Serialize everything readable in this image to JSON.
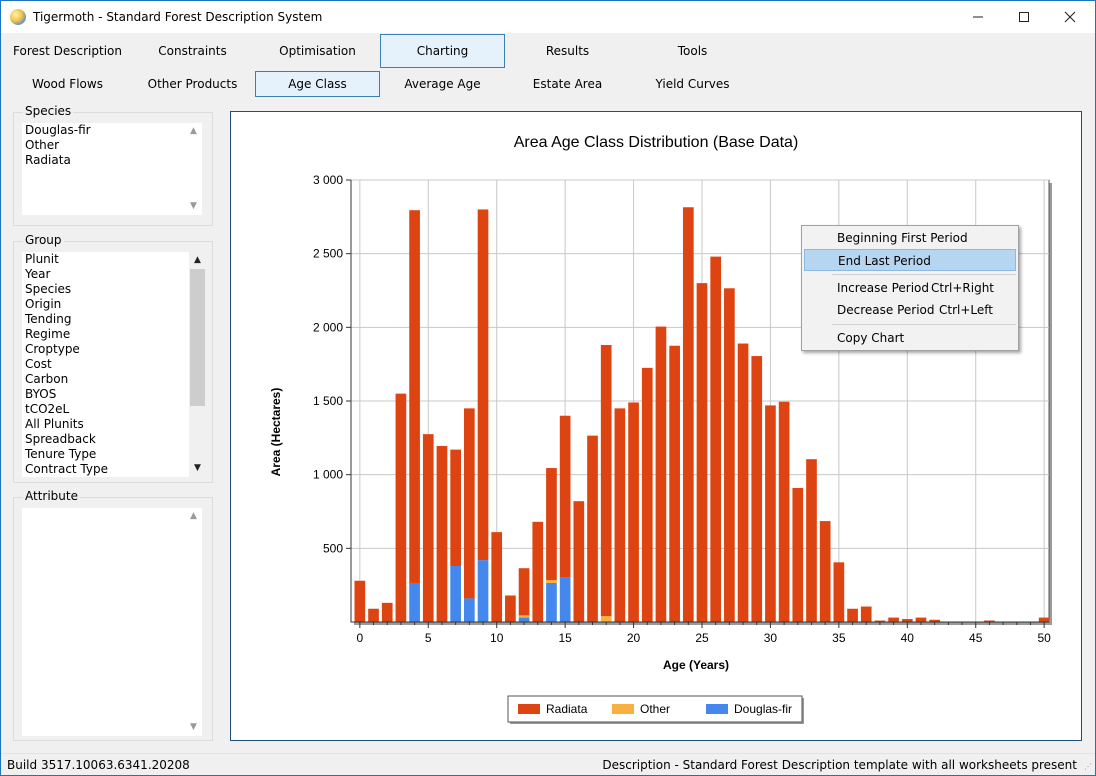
{
  "window": {
    "title": "Tigermoth - Standard Forest Description System",
    "icon": "globe-icon"
  },
  "tabs_row1": [
    {
      "label": "Forest Description"
    },
    {
      "label": "Constraints"
    },
    {
      "label": "Optimisation"
    },
    {
      "label": "Charting"
    },
    {
      "label": "Results"
    },
    {
      "label": "Tools"
    }
  ],
  "tabs_row2": [
    {
      "label": "Wood Flows"
    },
    {
      "label": "Other Products"
    },
    {
      "label": "Age Class"
    },
    {
      "label": "Average Age"
    },
    {
      "label": "Estate Area"
    },
    {
      "label": "Yield Curves"
    }
  ],
  "species": {
    "label": "Species",
    "items": [
      "Douglas-fir",
      "Other",
      "Radiata"
    ]
  },
  "group": {
    "label": "Group",
    "items": [
      "Plunit",
      "Year",
      "Species",
      "Origin",
      "Tending",
      "Regime",
      "Croptype",
      "Cost",
      "Carbon",
      "BYOS",
      "tCO2eL",
      "All Plunits",
      "Spreadback",
      "Tenure Type",
      "Contract Type"
    ]
  },
  "attribute": {
    "label": "Attribute"
  },
  "context_menu": {
    "items": [
      {
        "label": "Beginning First Period",
        "shortcut": ""
      },
      {
        "label": "End Last Period",
        "shortcut": ""
      },
      {
        "label": "Increase Period",
        "shortcut": "Ctrl+Right"
      },
      {
        "label": "Decrease Period",
        "shortcut": "Ctrl+Left"
      },
      {
        "label": "Copy Chart",
        "shortcut": ""
      }
    ]
  },
  "status": {
    "build": "Build 3517.10063.6341.20208",
    "description": "Description - Standard Forest Description template with all worksheets present"
  },
  "colors": {
    "radiata": "#dd4411",
    "other": "#f8b040",
    "douglas": "#4488ee",
    "accent": "#3c7fb1"
  },
  "chart_data": {
    "type": "bar",
    "stacked": true,
    "title": "Area Age Class Distribution (Base Data)",
    "xlabel": "Age (Years)",
    "ylabel": "Area (Hectares)",
    "xlim": [
      0,
      50
    ],
    "ylim": [
      0,
      3000
    ],
    "x_ticks": [
      "0",
      "5",
      "10",
      "15",
      "20",
      "25",
      "30",
      "35",
      "40",
      "45",
      "50"
    ],
    "y_ticks": [
      "500",
      "1 000",
      "1 500",
      "2 000",
      "2 500",
      "3 000"
    ],
    "grid": true,
    "legend_position": "bottom",
    "x": [
      0,
      1,
      2,
      3,
      4,
      5,
      6,
      7,
      8,
      9,
      10,
      11,
      12,
      13,
      14,
      15,
      16,
      17,
      18,
      19,
      20,
      21,
      22,
      23,
      24,
      25,
      26,
      27,
      28,
      29,
      30,
      31,
      32,
      33,
      34,
      35,
      36,
      37,
      38,
      39,
      40,
      41,
      42,
      43,
      44,
      45,
      46,
      47,
      48,
      49,
      50
    ],
    "series": [
      {
        "name": "Radiata",
        "color": "#dd4411",
        "values": [
          280,
          90,
          130,
          1550,
          2530,
          1275,
          1195,
          790,
          1290,
          2380,
          610,
          180,
          320,
          680,
          760,
          1095,
          820,
          1265,
          1840,
          1450,
          1490,
          1725,
          2005,
          1875,
          2815,
          2300,
          2480,
          2265,
          1890,
          1805,
          1470,
          1495,
          910,
          1105,
          685,
          405,
          90,
          105,
          10,
          30,
          20,
          30,
          15,
          0,
          0,
          0,
          10,
          0,
          0,
          0,
          30
        ]
      },
      {
        "name": "Other",
        "color": "#f8b040",
        "values": [
          0,
          0,
          0,
          0,
          0,
          0,
          0,
          0,
          0,
          0,
          0,
          0,
          15,
          0,
          20,
          0,
          0,
          0,
          40,
          0,
          0,
          0,
          0,
          0,
          0,
          0,
          0,
          0,
          0,
          0,
          0,
          0,
          0,
          0,
          0,
          0,
          0,
          0,
          0,
          0,
          0,
          0,
          0,
          0,
          0,
          0,
          0,
          0,
          0,
          0,
          0
        ]
      },
      {
        "name": "Douglas-fir",
        "color": "#4488ee",
        "values": [
          0,
          0,
          0,
          0,
          265,
          0,
          0,
          380,
          160,
          420,
          0,
          0,
          30,
          0,
          265,
          305,
          0,
          0,
          0,
          0,
          0,
          0,
          0,
          0,
          0,
          0,
          0,
          0,
          0,
          0,
          0,
          0,
          0,
          0,
          0,
          0,
          0,
          0,
          0,
          0,
          0,
          0,
          0,
          0,
          0,
          0,
          0,
          0,
          0,
          0,
          0
        ]
      }
    ]
  }
}
